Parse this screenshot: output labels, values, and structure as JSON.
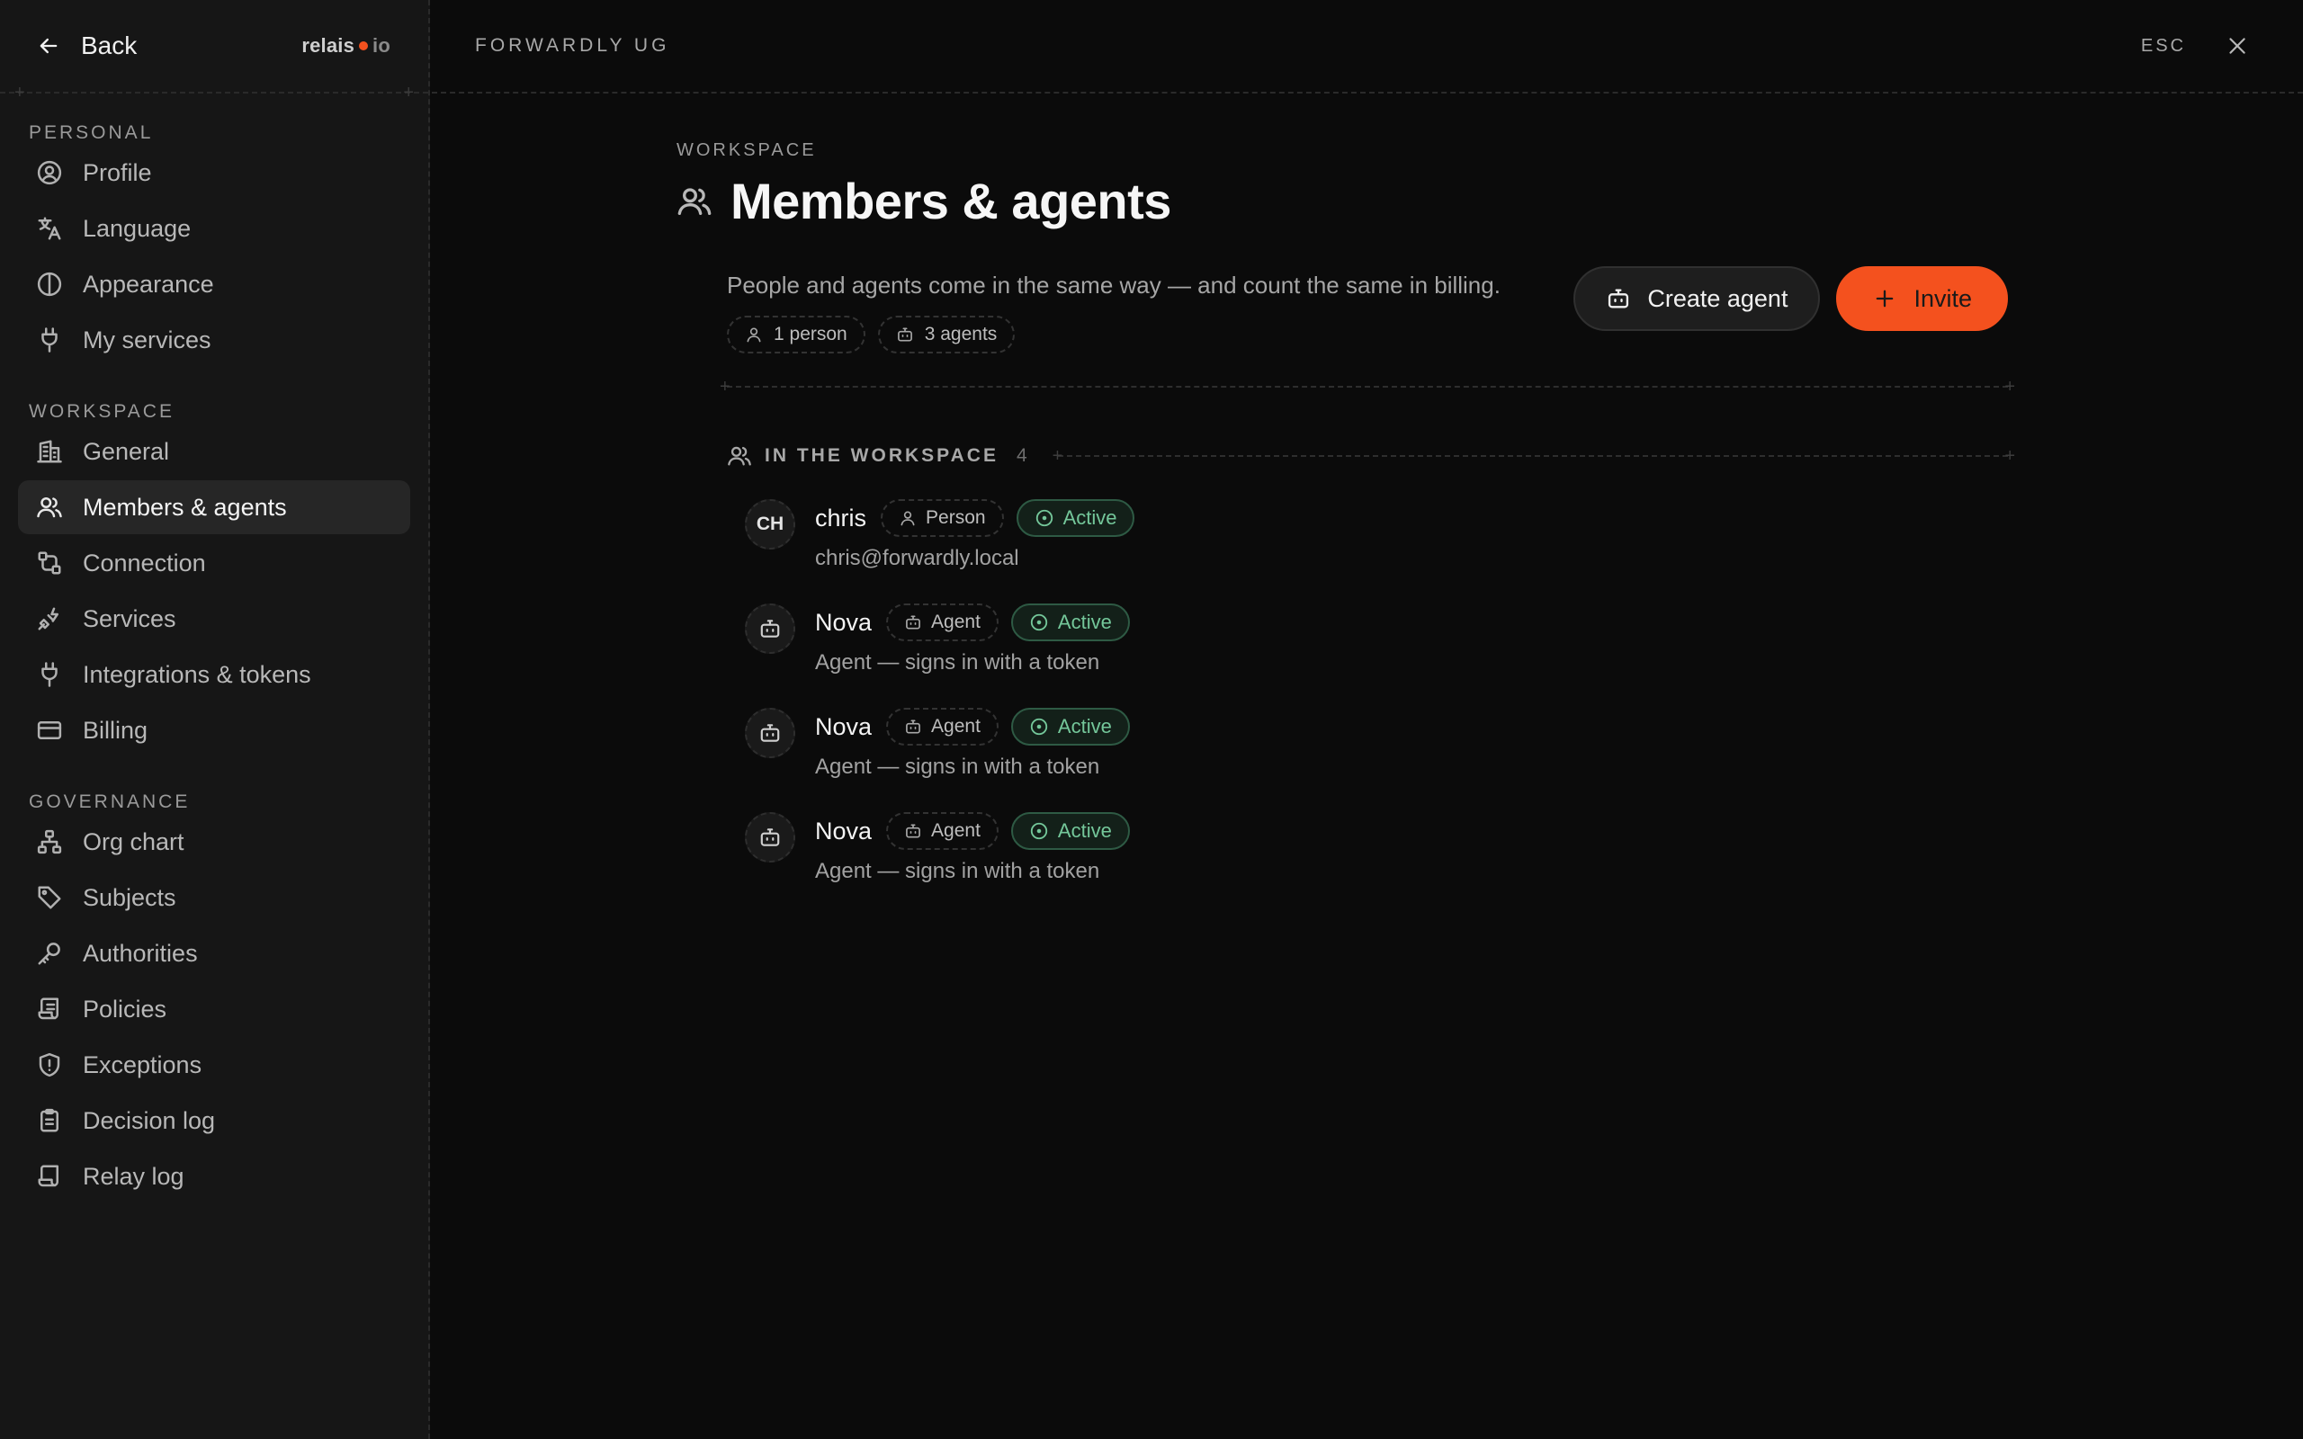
{
  "sidebar": {
    "back_label": "Back",
    "logo": {
      "part1": "relais",
      "part2": "io"
    },
    "sections": [
      {
        "heading": "PERSONAL",
        "items": [
          {
            "label": "Profile",
            "icon": "user-circle-icon"
          },
          {
            "label": "Language",
            "icon": "translate-icon"
          },
          {
            "label": "Appearance",
            "icon": "contrast-icon"
          },
          {
            "label": "My services",
            "icon": "plug-icon"
          }
        ]
      },
      {
        "heading": "WORKSPACE",
        "items": [
          {
            "label": "General",
            "icon": "building-icon"
          },
          {
            "label": "Members & agents",
            "icon": "users-icon",
            "active": true
          },
          {
            "label": "Connection",
            "icon": "route-icon"
          },
          {
            "label": "Services",
            "icon": "lightning-plug-icon"
          },
          {
            "label": "Integrations & tokens",
            "icon": "plug-icon"
          },
          {
            "label": "Billing",
            "icon": "credit-card-icon"
          }
        ]
      },
      {
        "heading": "GOVERNANCE",
        "items": [
          {
            "label": "Org chart",
            "icon": "org-chart-icon"
          },
          {
            "label": "Subjects",
            "icon": "tag-icon"
          },
          {
            "label": "Authorities",
            "icon": "key-icon"
          },
          {
            "label": "Policies",
            "icon": "scroll-icon"
          },
          {
            "label": "Exceptions",
            "icon": "shield-alert-icon"
          },
          {
            "label": "Decision log",
            "icon": "clipboard-icon"
          },
          {
            "label": "Relay log",
            "icon": "scroll-text-icon"
          }
        ]
      }
    ]
  },
  "topbar": {
    "org_name": "FORWARDLY UG",
    "esc_label": "ESC"
  },
  "main": {
    "eyebrow": "WORKSPACE",
    "title": "Members & agents",
    "description": "People and agents come in the same way — and count the same in billing.",
    "chips": [
      {
        "label": "1 person",
        "icon": "user-icon"
      },
      {
        "label": "3 agents",
        "icon": "bot-icon"
      }
    ],
    "actions": {
      "create_agent": "Create agent",
      "invite": "Invite"
    },
    "section": {
      "label": "IN THE WORKSPACE",
      "count": "4"
    },
    "members": [
      {
        "avatar": "CH",
        "name": "chris",
        "kind": "Person",
        "kind_icon": "user-icon",
        "status": "Active",
        "sub": "chris@forwardly.local"
      },
      {
        "avatar": "",
        "name": "Nova",
        "kind": "Agent",
        "kind_icon": "bot-icon",
        "status": "Active",
        "sub": "Agent — signs in with a token"
      },
      {
        "avatar": "",
        "name": "Nova",
        "kind": "Agent",
        "kind_icon": "bot-icon",
        "status": "Active",
        "sub": "Agent — signs in with a token"
      },
      {
        "avatar": "",
        "name": "Nova",
        "kind": "Agent",
        "kind_icon": "bot-icon",
        "status": "Active",
        "sub": "Agent — signs in with a token"
      }
    ]
  },
  "colors": {
    "accent": "#f4511e",
    "active_status": "#74c79a",
    "background": "#0b0b0b",
    "sidebar": "#161616"
  }
}
